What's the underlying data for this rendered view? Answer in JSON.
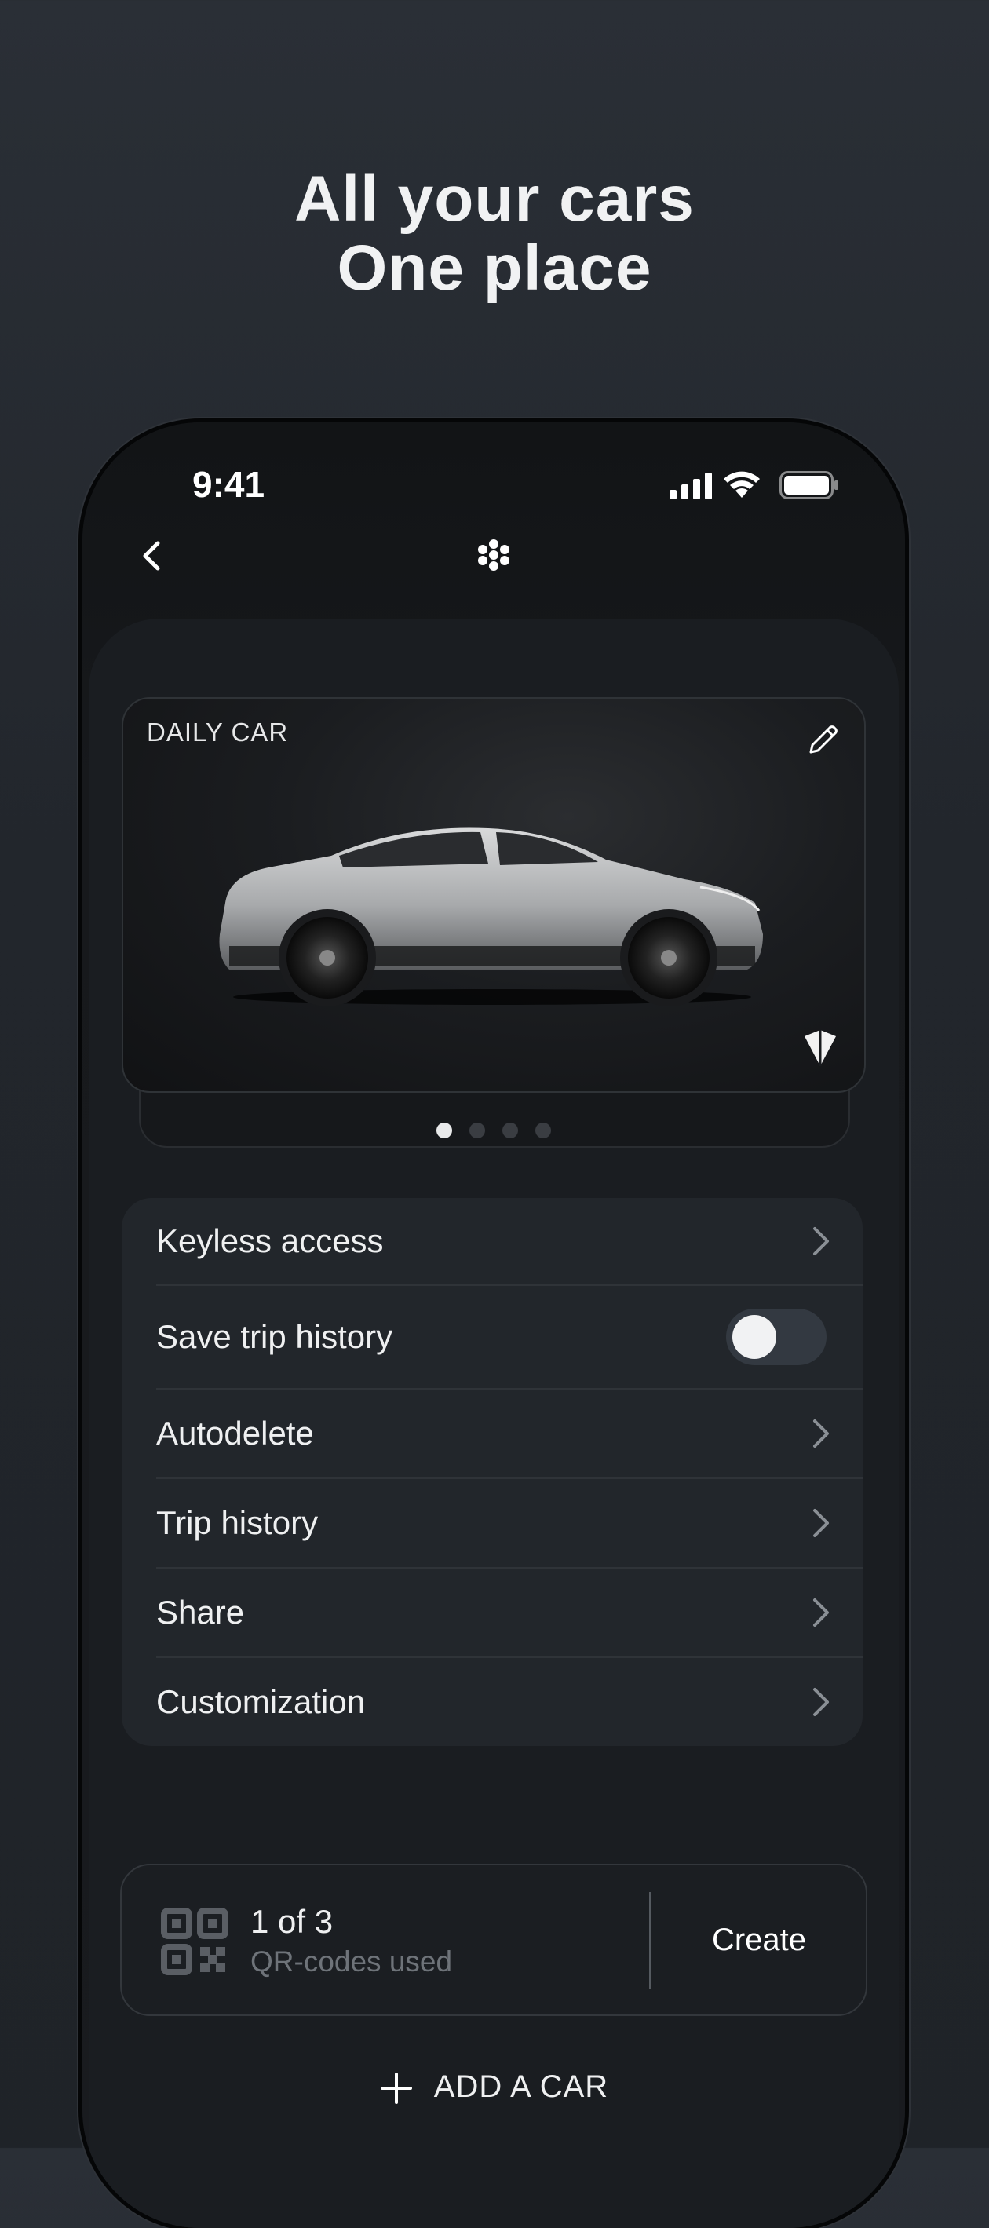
{
  "headline": {
    "line1": "All your cars",
    "line2": "One place"
  },
  "status_bar": {
    "time": "9:41"
  },
  "icons": {
    "back": "chevron-left-icon",
    "logo": "brand-logo-icon",
    "edit": "pencil-icon",
    "brand": "car-brand-icon",
    "qr": "qr-code-icon",
    "add": "plus-icon"
  },
  "car_card": {
    "label": "DAILY CAR"
  },
  "carousel": {
    "total": 4,
    "active": 0
  },
  "menu": {
    "items": [
      {
        "label": "Keyless access",
        "control": "chevron"
      },
      {
        "label": "Save trip history",
        "control": "toggle",
        "on": false
      },
      {
        "label": "Autodelete",
        "control": "chevron"
      },
      {
        "label": "Trip history",
        "control": "chevron"
      },
      {
        "label": "Share",
        "control": "chevron"
      },
      {
        "label": "Customization",
        "control": "chevron"
      }
    ]
  },
  "qr": {
    "count": "1 of 3",
    "sub": "QR-codes used",
    "button": "Create"
  },
  "add_car": {
    "label": "ADD A CAR"
  },
  "colors": {
    "background": "#23272d",
    "accent": "#eff0f1",
    "muted": "#6e7379"
  }
}
